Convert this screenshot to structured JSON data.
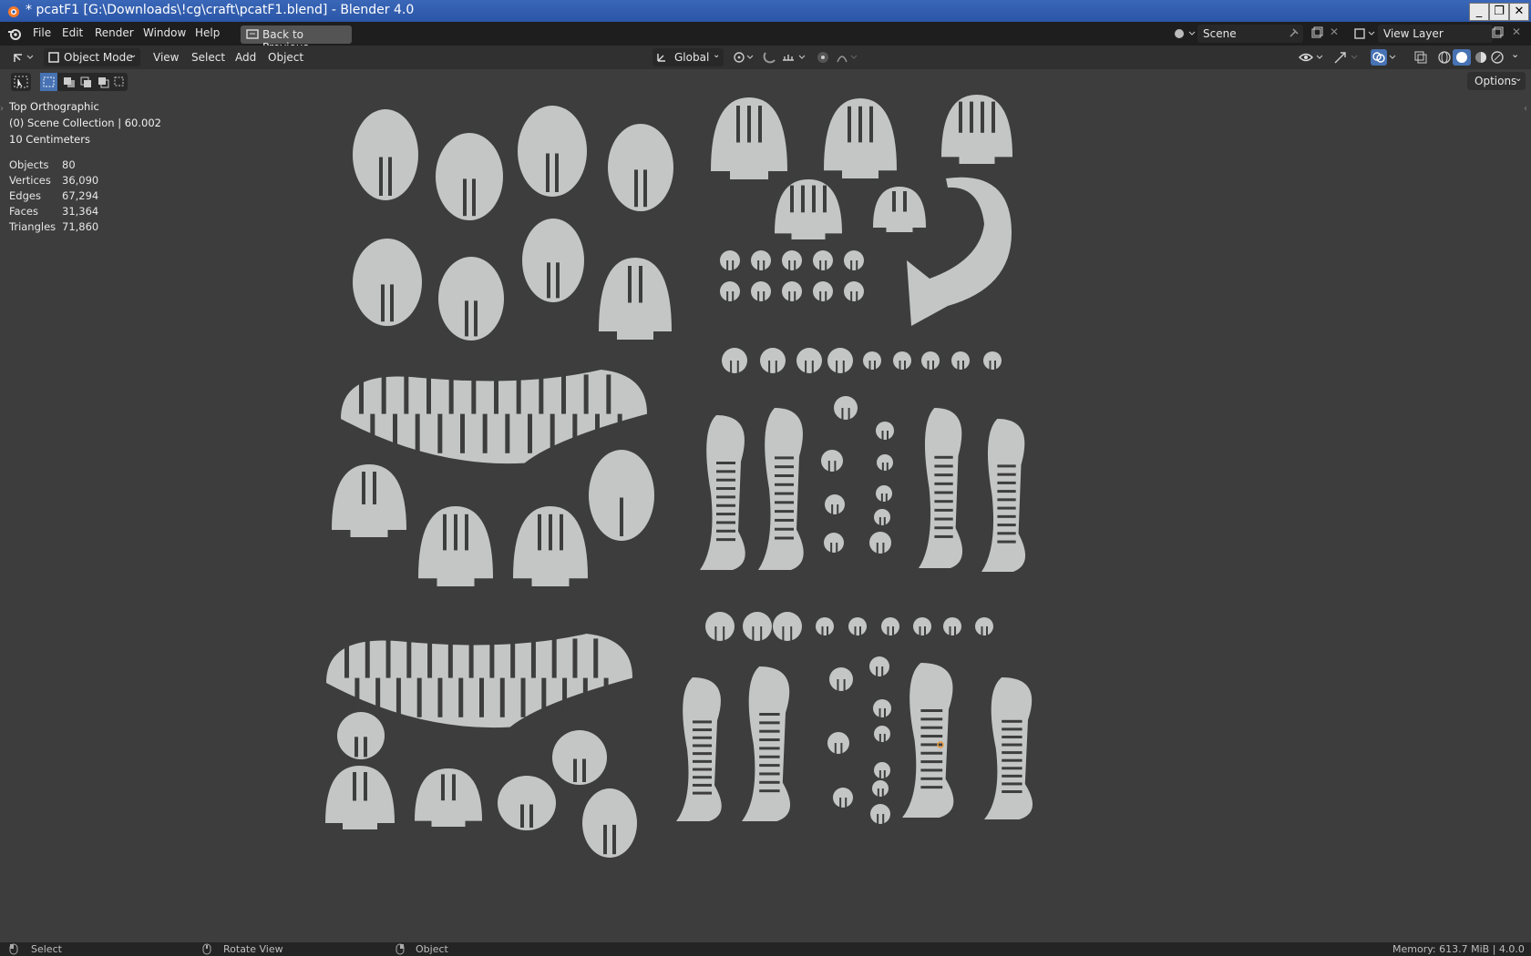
{
  "window": {
    "title": "* pcatF1 [G:\\Downloads\\!cg\\craft\\pcatF1.blend] - Blender 4.0",
    "controls": [
      "minimize-icon",
      "restore-icon",
      "close-icon"
    ]
  },
  "menubar": {
    "items": [
      "File",
      "Edit",
      "Render",
      "Window",
      "Help"
    ],
    "back_button": "Back to Previous",
    "scene_field": "Scene",
    "view_layer_field": "View Layer"
  },
  "viewport_header": {
    "mode": "Object Mode",
    "menus": [
      "View",
      "Select",
      "Add",
      "Object"
    ],
    "transform_orientation": "Global",
    "options": "Options"
  },
  "overlay": {
    "view_name": "Top Orthographic",
    "collection": "(0) Scene Collection | 60.002",
    "grid_scale": "10 Centimeters",
    "stats": [
      {
        "label": "Objects",
        "value": "80"
      },
      {
        "label": "Vertices",
        "value": "36,090"
      },
      {
        "label": "Edges",
        "value": "67,294"
      },
      {
        "label": "Faces",
        "value": "31,364"
      },
      {
        "label": "Triangles",
        "value": "71,860"
      }
    ]
  },
  "statusbar": {
    "left": "Select",
    "middle": "Rotate View",
    "right_action": "Object",
    "memory": "Memory: 613.7 MiB | 4.0.0"
  },
  "colors": {
    "viewport_bg": "#3d3d3d",
    "piece_fill": "#c4c6c6",
    "slot": "#3d3d3d",
    "title_bar": "#2b55a6"
  }
}
